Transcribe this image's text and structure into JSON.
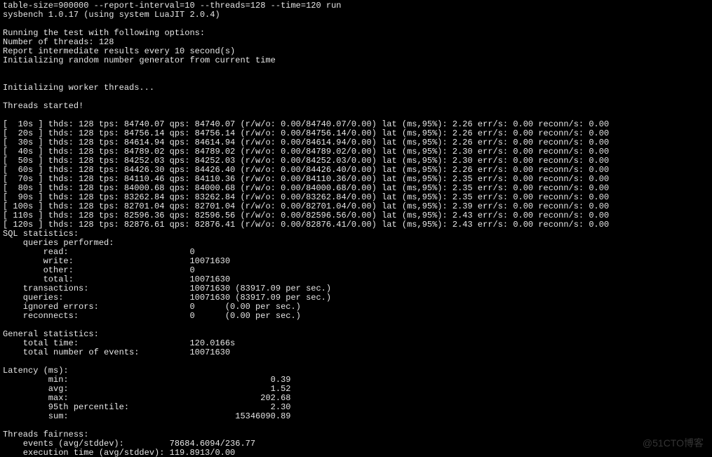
{
  "header": {
    "line1": "table-size=900000 --report-interval=10 --threads=128 --time=120 run",
    "line2": "sysbench 1.0.17 (using system LuaJIT 2.0.4)"
  },
  "options_block": {
    "l1": "Running the test with following options:",
    "l2": "Number of threads: 128",
    "l3": "Report intermediate results every 10 second(s)",
    "l4": "Initializing random number generator from current time"
  },
  "init": {
    "l1": "Initializing worker threads...",
    "l2": "Threads started!"
  },
  "intervals": [
    {
      "t": "10s",
      "thds": 128,
      "tps": "84740.07",
      "qps": "84740.07",
      "rwo": "0.00/84740.07/0.00",
      "lat": "2.26",
      "err": "0.00",
      "reconn": "0.00"
    },
    {
      "t": "20s",
      "thds": 128,
      "tps": "84756.14",
      "qps": "84756.14",
      "rwo": "0.00/84756.14/0.00",
      "lat": "2.26",
      "err": "0.00",
      "reconn": "0.00"
    },
    {
      "t": "30s",
      "thds": 128,
      "tps": "84614.94",
      "qps": "84614.94",
      "rwo": "0.00/84614.94/0.00",
      "lat": "2.26",
      "err": "0.00",
      "reconn": "0.00"
    },
    {
      "t": "40s",
      "thds": 128,
      "tps": "84789.02",
      "qps": "84789.02",
      "rwo": "0.00/84789.02/0.00",
      "lat": "2.30",
      "err": "0.00",
      "reconn": "0.00"
    },
    {
      "t": "50s",
      "thds": 128,
      "tps": "84252.03",
      "qps": "84252.03",
      "rwo": "0.00/84252.03/0.00",
      "lat": "2.30",
      "err": "0.00",
      "reconn": "0.00"
    },
    {
      "t": "60s",
      "thds": 128,
      "tps": "84426.30",
      "qps": "84426.40",
      "rwo": "0.00/84426.40/0.00",
      "lat": "2.26",
      "err": "0.00",
      "reconn": "0.00"
    },
    {
      "t": "70s",
      "thds": 128,
      "tps": "84110.46",
      "qps": "84110.36",
      "rwo": "0.00/84110.36/0.00",
      "lat": "2.35",
      "err": "0.00",
      "reconn": "0.00"
    },
    {
      "t": "80s",
      "thds": 128,
      "tps": "84000.68",
      "qps": "84000.68",
      "rwo": "0.00/84000.68/0.00",
      "lat": "2.35",
      "err": "0.00",
      "reconn": "0.00"
    },
    {
      "t": "90s",
      "thds": 128,
      "tps": "83262.84",
      "qps": "83262.84",
      "rwo": "0.00/83262.84/0.00",
      "lat": "2.35",
      "err": "0.00",
      "reconn": "0.00"
    },
    {
      "t": "100s",
      "thds": 128,
      "tps": "82701.04",
      "qps": "82701.04",
      "rwo": "0.00/82701.04/0.00",
      "lat": "2.39",
      "err": "0.00",
      "reconn": "0.00"
    },
    {
      "t": "110s",
      "thds": 128,
      "tps": "82596.36",
      "qps": "82596.56",
      "rwo": "0.00/82596.56/0.00",
      "lat": "2.43",
      "err": "0.00",
      "reconn": "0.00"
    },
    {
      "t": "120s",
      "thds": 128,
      "tps": "82876.61",
      "qps": "82876.41",
      "rwo": "0.00/82876.41/0.00",
      "lat": "2.43",
      "err": "0.00",
      "reconn": "0.00"
    }
  ],
  "sql_stats": {
    "title": "SQL statistics:",
    "queries_performed": "    queries performed:",
    "read": {
      "label": "        read:",
      "value": "0"
    },
    "write": {
      "label": "        write:",
      "value": "10071630"
    },
    "other": {
      "label": "        other:",
      "value": "0"
    },
    "total": {
      "label": "        total:",
      "value": "10071630"
    },
    "transactions": {
      "label": "    transactions:",
      "value": "10071630 (83917.09 per sec.)"
    },
    "queries": {
      "label": "    queries:",
      "value": "10071630 (83917.09 per sec.)"
    },
    "ignored": {
      "label": "    ignored errors:",
      "value": "0      (0.00 per sec.)"
    },
    "reconnects": {
      "label": "    reconnects:",
      "value": "0      (0.00 per sec.)"
    }
  },
  "general": {
    "title": "General statistics:",
    "total_time": {
      "label": "    total time:",
      "value": "120.0166s"
    },
    "total_events": {
      "label": "    total number of events:",
      "value": "10071630"
    }
  },
  "latency": {
    "title": "Latency (ms):",
    "min": {
      "label": "         min:",
      "value": "0.39"
    },
    "avg": {
      "label": "         avg:",
      "value": "1.52"
    },
    "max": {
      "label": "         max:",
      "value": "202.68"
    },
    "p95": {
      "label": "         95th percentile:",
      "value": "2.30"
    },
    "sum": {
      "label": "         sum:",
      "value": "15346090.89"
    }
  },
  "fairness": {
    "title": "Threads fairness:",
    "events": {
      "label": "    events (avg/stddev):",
      "value": "78684.6094/236.77"
    },
    "exec": {
      "label": "    execution time (avg/stddev):",
      "value": "119.8913/0.00"
    }
  },
  "watermark": "@51CTO博客"
}
